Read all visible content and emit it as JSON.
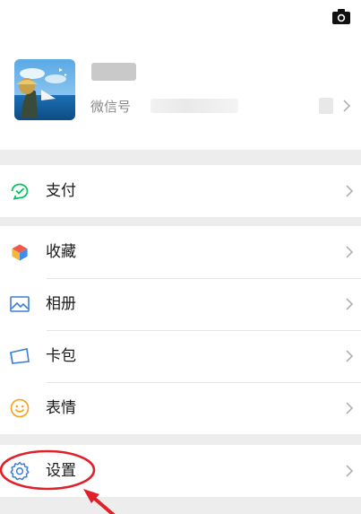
{
  "profile": {
    "wechat_id_label": "微信号",
    "avatar_alt": "avatar"
  },
  "menu": {
    "pay": {
      "label": "支付",
      "icon": "wallet-check-icon"
    },
    "favorites": {
      "label": "收藏",
      "icon": "cube-icon"
    },
    "album": {
      "label": "相册",
      "icon": "image-icon"
    },
    "cards": {
      "label": "卡包",
      "icon": "card-icon"
    },
    "stickers": {
      "label": "表情",
      "icon": "smile-icon"
    },
    "settings": {
      "label": "设置",
      "icon": "gear-icon"
    }
  },
  "colors": {
    "accent_green": "#07c160",
    "annotation_red": "#e0202a"
  }
}
